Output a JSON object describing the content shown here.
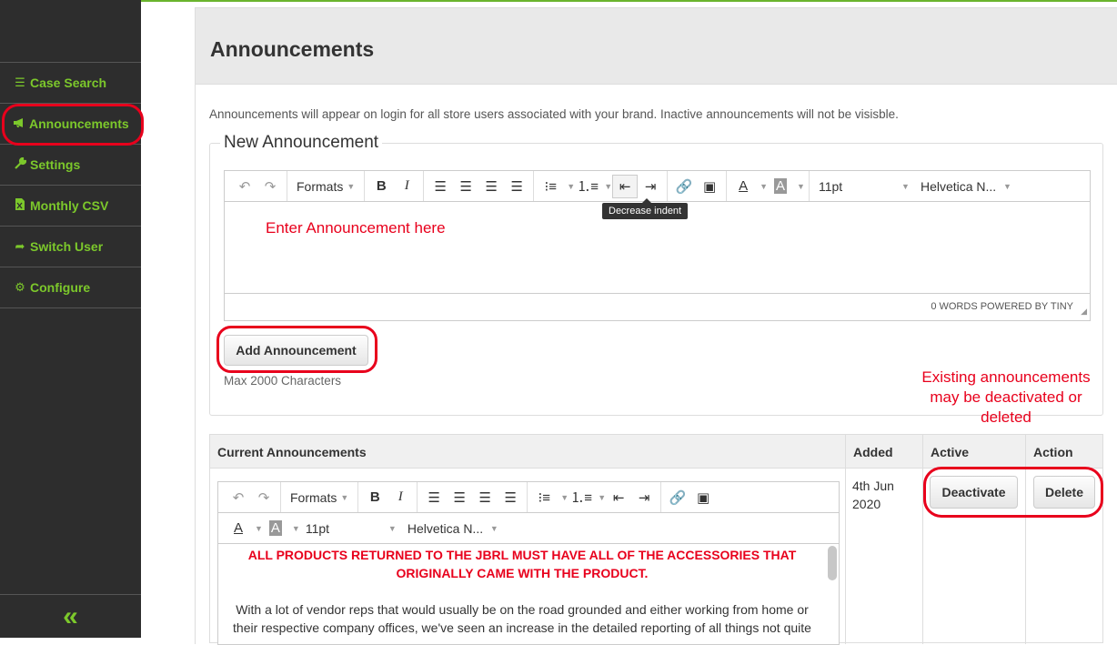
{
  "sidebar": {
    "items": [
      {
        "label": "Case Search",
        "icon": "list-icon",
        "glyph": "☰"
      },
      {
        "label": "Announcements",
        "icon": "megaphone-icon",
        "glyph": "📢"
      },
      {
        "label": "Settings",
        "icon": "wrench-icon",
        "glyph": "🔧"
      },
      {
        "label": "Monthly CSV",
        "icon": "file-excel-icon",
        "glyph": "▤"
      },
      {
        "label": "Switch User",
        "icon": "share-arrow-icon",
        "glyph": "➦"
      },
      {
        "label": "Configure",
        "icon": "gears-icon",
        "glyph": "⚙"
      }
    ],
    "collapse_glyph": "«"
  },
  "page": {
    "title": "Announcements",
    "intro": "Announcements will appear on login for all store users associated with your brand. Inactive announcements will not be visisble."
  },
  "new_announcement": {
    "legend": "New Announcement",
    "toolbar": {
      "formats": "Formats",
      "font_size": "11pt",
      "font_family": "Helvetica N...",
      "tooltip": "Decrease indent"
    },
    "editor_placeholder_annotation": "Enter Announcement here",
    "status": "0 WORDS POWERED BY TINY",
    "add_button": "Add Announcement",
    "max_note": "Max 2000 Characters"
  },
  "annotation_note": "Existing announcements may be deactivated or deleted",
  "current": {
    "headers": [
      "Current Announcements",
      "Added",
      "Active",
      "Action"
    ],
    "rows": [
      {
        "added": "4th Jun 2020",
        "toolbar": {
          "formats": "Formats",
          "font_size": "11pt",
          "font_family": "Helvetica N..."
        },
        "content_red": "ALL PRODUCTS RETURNED TO THE JBRL MUST HAVE ALL OF THE ACCESSORIES THAT ORIGINALLY CAME WITH THE PRODUCT.",
        "content_body": "With a lot of vendor reps that would usually be on the road grounded and either working from home or their respective company offices, we've seen an increase in the detailed reporting of all things not quite",
        "deactivate_label": "Deactivate",
        "delete_label": "Delete"
      }
    ]
  },
  "colors": {
    "sidebar_bg": "#2d2d2d",
    "accent_green": "#7cc82b",
    "annotation_red": "#e8001c"
  }
}
